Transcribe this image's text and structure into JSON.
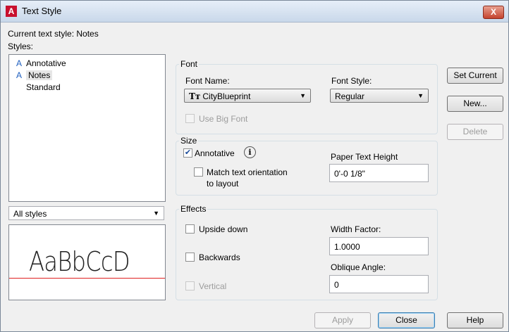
{
  "window": {
    "title": "Text Style",
    "close_glyph": "X",
    "app_icon_letter": "A"
  },
  "current_style": {
    "label": "Current text style:",
    "value": "Notes"
  },
  "styles": {
    "label": "Styles:",
    "items": [
      {
        "label": "Annotative",
        "icon": "annotative-icon",
        "icon_glyph": "A"
      },
      {
        "label": "Notes",
        "icon": "annotative-icon",
        "icon_glyph": "A",
        "selected": true
      },
      {
        "label": "Standard",
        "icon": "",
        "icon_glyph": ""
      }
    ]
  },
  "filter": {
    "value": "All styles"
  },
  "preview": {
    "text": "AaBbCcD",
    "baseline_color": "#e02020"
  },
  "font": {
    "group_title": "Font",
    "name_label": "Font Name:",
    "name_value": "CityBlueprint",
    "name_icon_glyph": "Tт",
    "style_label": "Font Style:",
    "style_value": "Regular",
    "big_font_label": "Use Big Font"
  },
  "size": {
    "group_title": "Size",
    "annotative_label": "Annotative",
    "annotative_checked": true,
    "info_glyph": "i",
    "match_label_line1": "Match text orientation",
    "match_label_line2": "to layout",
    "paper_height_label": "Paper Text Height",
    "paper_height_value": "0'-0 1/8\""
  },
  "effects": {
    "group_title": "Effects",
    "upside_down_label": "Upside down",
    "backwards_label": "Backwards",
    "vertical_label": "Vertical",
    "width_factor_label": "Width Factor:",
    "width_factor_value": "1.0000",
    "oblique_label": "Oblique Angle:",
    "oblique_value": "0"
  },
  "buttons": {
    "set_current": "Set Current",
    "new": "New...",
    "delete": "Delete",
    "apply": "Apply",
    "close": "Close",
    "help": "Help"
  },
  "colors": {
    "accent": "#1f5fbf",
    "title_gradient_top": "#e6eef8",
    "close_red": "#c4432d"
  }
}
